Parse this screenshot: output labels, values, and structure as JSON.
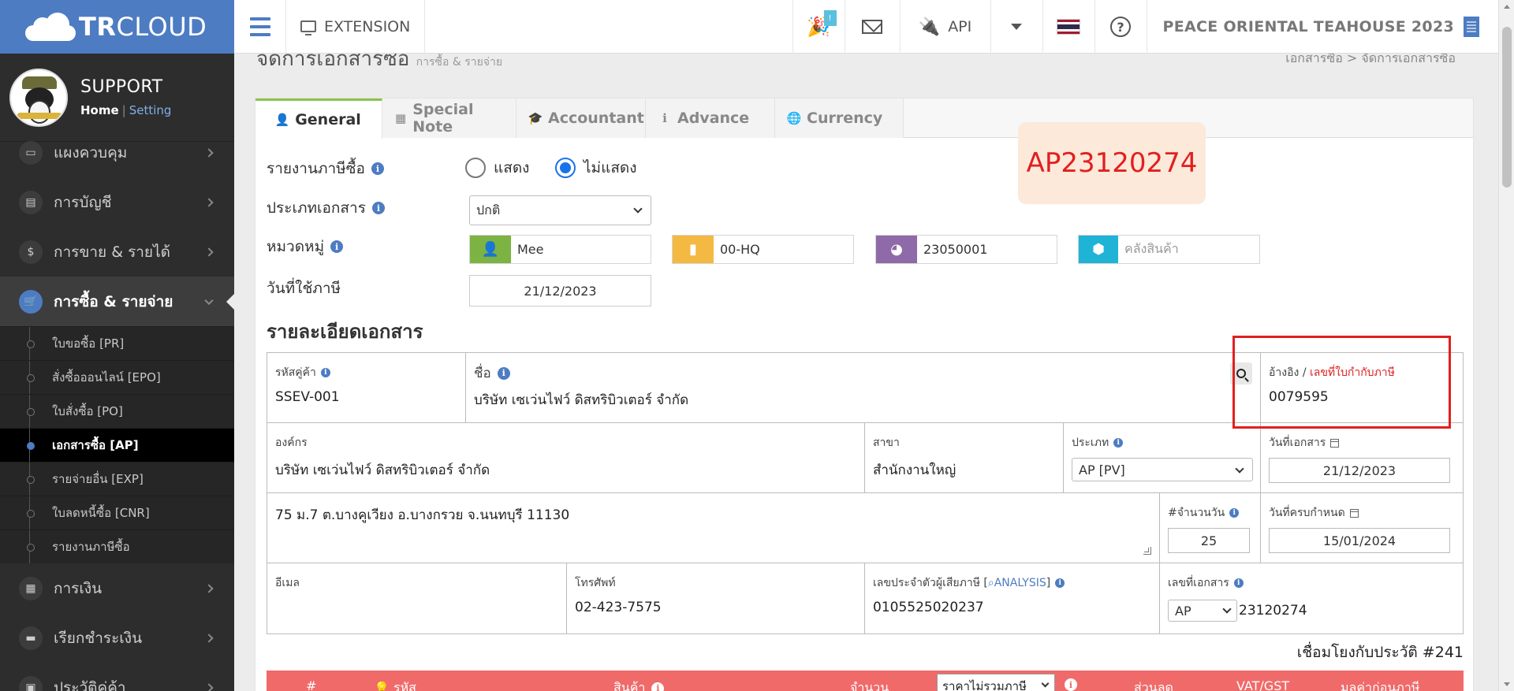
{
  "app": {
    "logo_text_bold": "TR",
    "logo_text": "CLOUD",
    "profile_name": "SUPPORT",
    "home_link": "Home",
    "link_separator": "|",
    "setting_link": "Setting",
    "accent_color": "#4d7cc2"
  },
  "sidebar": {
    "items_top": [
      {
        "label": "แผงควบคุม",
        "icon": "monitor-icon"
      },
      {
        "label": "การบัญชี",
        "icon": "book-icon"
      },
      {
        "label": "การขาย & รายได้",
        "icon": "dollar-icon"
      }
    ],
    "active_item": {
      "label": "การซื้อ & รายจ่าย",
      "icon": "cart-icon"
    },
    "sub_items": [
      {
        "label": "ใบขอซื้อ [PR]"
      },
      {
        "label": "สั่งซื้อออนไลน์ [EPO]"
      },
      {
        "label": "ใบสั่งซื้อ [PO]"
      },
      {
        "label": "เอกสารซื้อ [AP]"
      },
      {
        "label": "รายจ่ายอื่น [EXP]"
      },
      {
        "label": "ใบลดหนี้ซื้อ [CNR]"
      },
      {
        "label": "รายงานภาษีซื้อ"
      }
    ],
    "items_bottom": [
      {
        "label": "การเงิน",
        "icon": "calendar-icon"
      },
      {
        "label": "เรียกชำระเงิน",
        "icon": "credit-card-icon"
      },
      {
        "label": "ประวัติคู่ค้า",
        "icon": "contact-icon"
      }
    ]
  },
  "topbar": {
    "extension_label": "EXTENSION",
    "badge_count": "!",
    "api_label": "API",
    "company_name": "PEACE ORIENTAL TEAHOUSE 2023",
    "help_symbol": "?"
  },
  "page": {
    "title": "จัดการเอกสารซื้อ",
    "subtitle": "การซื้อ & รายจ่าย",
    "breadcrumb_1": "เอกสารซื้อ",
    "breadcrumb_sep": ">",
    "breadcrumb_2": "จัดการเอกสารซื้อ"
  },
  "tabs": [
    {
      "label": "General"
    },
    {
      "label": "Special Note"
    },
    {
      "label": "Accountant"
    },
    {
      "label": "Advance"
    },
    {
      "label": "Currency"
    }
  ],
  "doc_code": "AP23120274",
  "form": {
    "tax_report_label": "รายงานภาษีซื้อ",
    "radio_show": "แสดง",
    "radio_hide": "ไม่แสดง",
    "doc_type_label": "ประเภทเอกสาร",
    "doc_type_value": "ปกติ",
    "category_label": "หมวดหมู่",
    "category_user": "Mee",
    "category_branch": "00-HQ",
    "category_project": "23050001",
    "category_warehouse_placeholder": "คลังสินค้า",
    "tax_date_label": "วันที่ใช้ภาษี",
    "tax_date_value": "21/12/2023",
    "colors": {
      "green": "#7cb342",
      "yellow": "#f4b942",
      "purple": "#8e6aa8",
      "cyan": "#1fb3d6"
    }
  },
  "details": {
    "section_title": "รายละเอียดเอกสาร",
    "vendor_code_label": "รหัสคู่ค้า",
    "vendor_code": "SSEV-001",
    "name_label": "ชื่อ",
    "name_value": "บริษัท เซเว่นไฟว์ ดิสทริบิวเตอร์ จำกัด",
    "ref_label": "อ้างอิง",
    "ref_sep": "/",
    "tax_invoice_label": "เลขที่ใบกำกับภาษี",
    "ref_value": "0079595",
    "org_label": "องค์กร",
    "org_value": "บริษัท เซเว่นไฟว์ ดิสทริบิวเตอร์ จำกัด",
    "branch_label": "สาขา",
    "branch_value": "สำนักงานใหญ่",
    "type_label": "ประเภท",
    "type_value": "AP [PV]",
    "doc_date_label": "วันที่เอกสาร",
    "doc_date_value": "21/12/2023",
    "address_value": "75 ม.7 ต.บางคูเวียง อ.บางกรวย จ.นนทบุรี 11130",
    "days_label": "#จำนวนวัน",
    "days_value": "25",
    "due_date_label": "วันที่ครบกำหนด",
    "due_date_value": "15/01/2024",
    "email_label": "อีเมล",
    "phone_label": "โทรศัพท์",
    "phone_value": "02-423-7575",
    "taxid_label": "เลขประจำตัวผู้เสียภาษี",
    "analysis_label": "ANALYSIS",
    "taxid_value": "0105525020237",
    "docno_label": "เลขที่เอกสาร",
    "docno_prefix": "AP",
    "docno_value": "23120274",
    "link_text": "เชื่อมโยงกับประวัติ #241"
  },
  "table": {
    "col_no": "#",
    "col_code": "รหัส",
    "col_product": "สินค้า",
    "col_qty": "จำนวน",
    "price_mode": "ราคาไม่รวมภาษี",
    "col_discount": "ส่วนลด",
    "col_vat": "VAT/GST",
    "col_before_tax": "มูลค่าก่อนภาษี"
  }
}
